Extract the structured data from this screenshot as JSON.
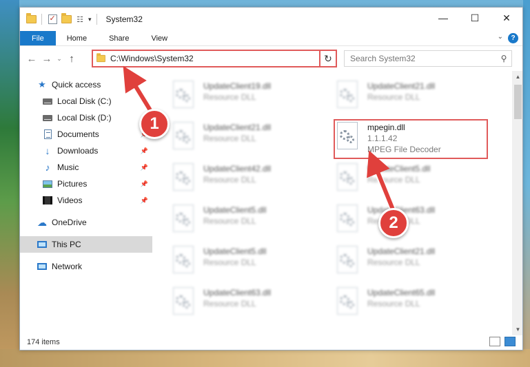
{
  "window": {
    "title": "System32"
  },
  "ribbon": {
    "tabs": [
      "File",
      "Home",
      "Share",
      "View"
    ]
  },
  "address": {
    "path": "C:\\Windows\\System32"
  },
  "search": {
    "placeholder": "Search System32"
  },
  "nav": {
    "items": [
      {
        "label": "Quick access",
        "icon": "star-icon"
      },
      {
        "label": "Local Disk (C:)",
        "icon": "drive-icon"
      },
      {
        "label": "Local Disk (D:)",
        "icon": "drive-icon"
      },
      {
        "label": "Documents",
        "icon": "documents-icon"
      },
      {
        "label": "Downloads",
        "icon": "downloads-icon"
      },
      {
        "label": "Music",
        "icon": "music-icon"
      },
      {
        "label": "Pictures",
        "icon": "pictures-icon"
      },
      {
        "label": "Videos",
        "icon": "videos-icon"
      },
      {
        "label": "OneDrive",
        "icon": "cloud-icon"
      },
      {
        "label": "This PC",
        "icon": "computer-icon"
      },
      {
        "label": "Network",
        "icon": "network-icon"
      }
    ]
  },
  "files": [
    {
      "name": "UpdateClient19.dll",
      "sub": "Resource DLL"
    },
    {
      "name": "UpdateClient21.dll",
      "sub": "Resource DLL"
    },
    {
      "name": "UpdateClient21.dll",
      "sub": "Resource DLL"
    },
    {
      "name": "mpegin.dll",
      "version": "1.1.1.42",
      "sub": "MPEG File Decoder"
    },
    {
      "name": "UpdateClient42.dll",
      "sub": "Resource DLL"
    },
    {
      "name": "UpdateClient5.dll",
      "sub": "Resource DLL"
    },
    {
      "name": "UpdateClient5.dll",
      "sub": "Resource DLL"
    },
    {
      "name": "UpdateClient63.dll",
      "sub": "Resource DLL"
    },
    {
      "name": "UpdateClient5.dll",
      "sub": "Resource DLL"
    },
    {
      "name": "UpdateClient21.dll",
      "sub": "Resource DLL"
    },
    {
      "name": "UpdateClient63.dll",
      "sub": "Resource DLL"
    },
    {
      "name": "UpdateClient65.dll",
      "sub": "Resource DLL"
    }
  ],
  "status": {
    "count": "174 items"
  },
  "callouts": [
    "1",
    "2"
  ],
  "colors": {
    "accent": "#1979ca",
    "highlight": "#e05a5a",
    "badge": "#e0403c"
  }
}
